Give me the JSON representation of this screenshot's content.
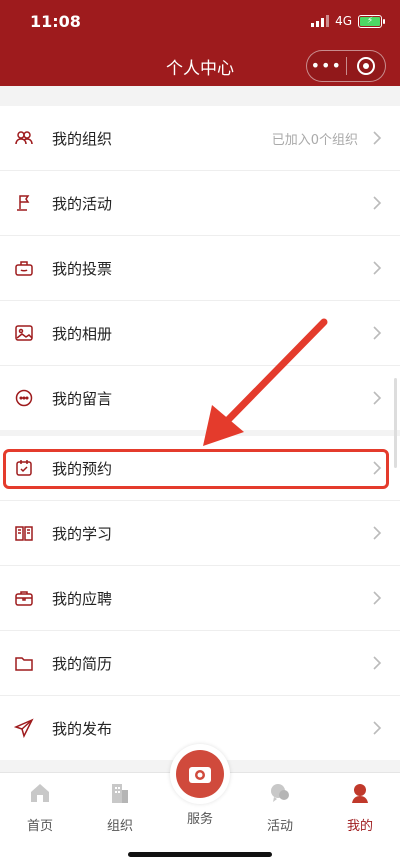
{
  "status": {
    "time": "11:08",
    "network": "4G"
  },
  "header": {
    "title": "个人中心",
    "more": "•••"
  },
  "group1": [
    {
      "label": "我的组织",
      "note": "已加入0个组织",
      "icon": "people-icon"
    },
    {
      "label": "我的活动",
      "icon": "flag-icon"
    },
    {
      "label": "我的投票",
      "icon": "ballot-icon"
    },
    {
      "label": "我的相册",
      "icon": "photo-icon"
    },
    {
      "label": "我的留言",
      "icon": "chat-bubble-icon"
    }
  ],
  "group2": [
    {
      "label": "我的预约",
      "icon": "calendar-check-icon"
    },
    {
      "label": "我的学习",
      "icon": "book-icon"
    },
    {
      "label": "我的应聘",
      "icon": "briefcase-icon"
    },
    {
      "label": "我的简历",
      "icon": "folder-icon"
    },
    {
      "label": "我的发布",
      "icon": "paper-plane-icon"
    }
  ],
  "tabs": {
    "home": "首页",
    "org": "组织",
    "service": "服务",
    "activity": "活动",
    "mine": "我的"
  },
  "colors": {
    "brand": "#9e1b1d",
    "highlight": "#e43b2c"
  }
}
